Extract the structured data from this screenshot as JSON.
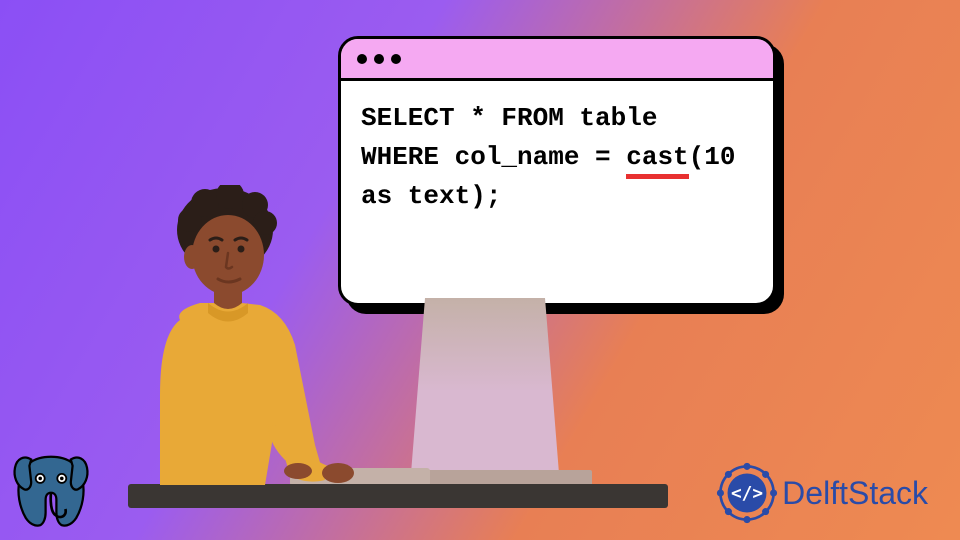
{
  "code": {
    "line1_part1": "SELECT * FROM table",
    "line2_part1": "WHERE col_name = ",
    "line2_underlined": "cast",
    "line2_part2": "(10",
    "line3": "as text);"
  },
  "branding": {
    "delftstack_text": "DelftStack"
  },
  "colors": {
    "titlebar": "#f5a9f2",
    "underline": "#e83030",
    "desk": "#3a3633",
    "brand_blue": "#2a4ba8",
    "pg_blue": "#336791"
  }
}
